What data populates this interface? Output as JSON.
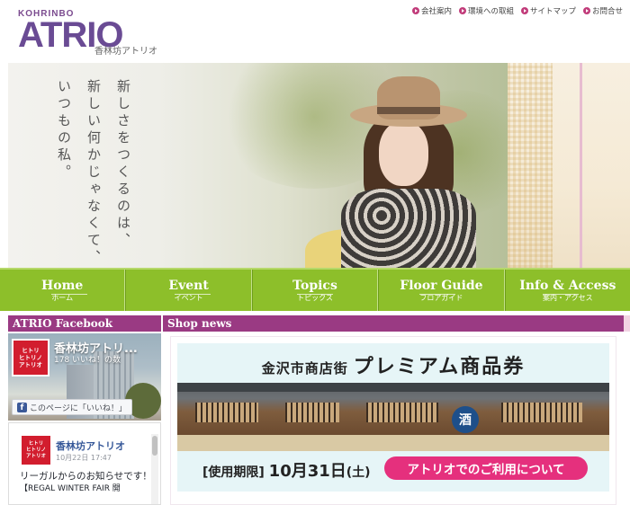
{
  "header": {
    "logo_small": "KOHRINBO",
    "logo_big": "ATRIO",
    "logo_ja": "香林坊アトリオ"
  },
  "util_nav": [
    {
      "label": "会社案内"
    },
    {
      "label": "環境への取組"
    },
    {
      "label": "サイトマップ"
    },
    {
      "label": "お問合せ"
    }
  ],
  "hero": {
    "lines": [
      "新しさをつくるのは、",
      "新しい何かじゃなくて、",
      "いつもの私。"
    ]
  },
  "nav": [
    {
      "en": "Home",
      "ja": "ホーム"
    },
    {
      "en": "Event",
      "ja": "イベント"
    },
    {
      "en": "Topics",
      "ja": "トピックス"
    },
    {
      "en": "Floor Guide",
      "ja": "フロアガイド"
    },
    {
      "en": "Info & Access",
      "ja": "案内・アクセス"
    }
  ],
  "facebook": {
    "heading": "ATRIO Facebook",
    "page_name": "香林坊アトリ...",
    "likes": "178 いいね！の数",
    "like_button": "このページに「いいね！」",
    "avatar_text": [
      "ヒトリ",
      "ヒトリノ",
      "アトリオ"
    ],
    "post": {
      "name": "香林坊アトリオ",
      "time": "10月22日 17:47",
      "text": "リーガルからのお知らせです！",
      "text2": "【REGAL WINTER FAIR 開"
    }
  },
  "shop_news": {
    "heading": "Shop news",
    "banner_sub": "金沢市商店街",
    "banner_title": "プレミアム商品券",
    "sake": "酒",
    "expire_label": "[使用期限]",
    "expire_date": "10月31日",
    "expire_day": "(土)",
    "cta": "アトリオでのご利用について"
  },
  "colors": {
    "brand_purple": "#6a4b94",
    "nav_green": "#8dbf2a",
    "heading_magenta": "#9a3a83",
    "cta_pink": "#e5307d"
  }
}
